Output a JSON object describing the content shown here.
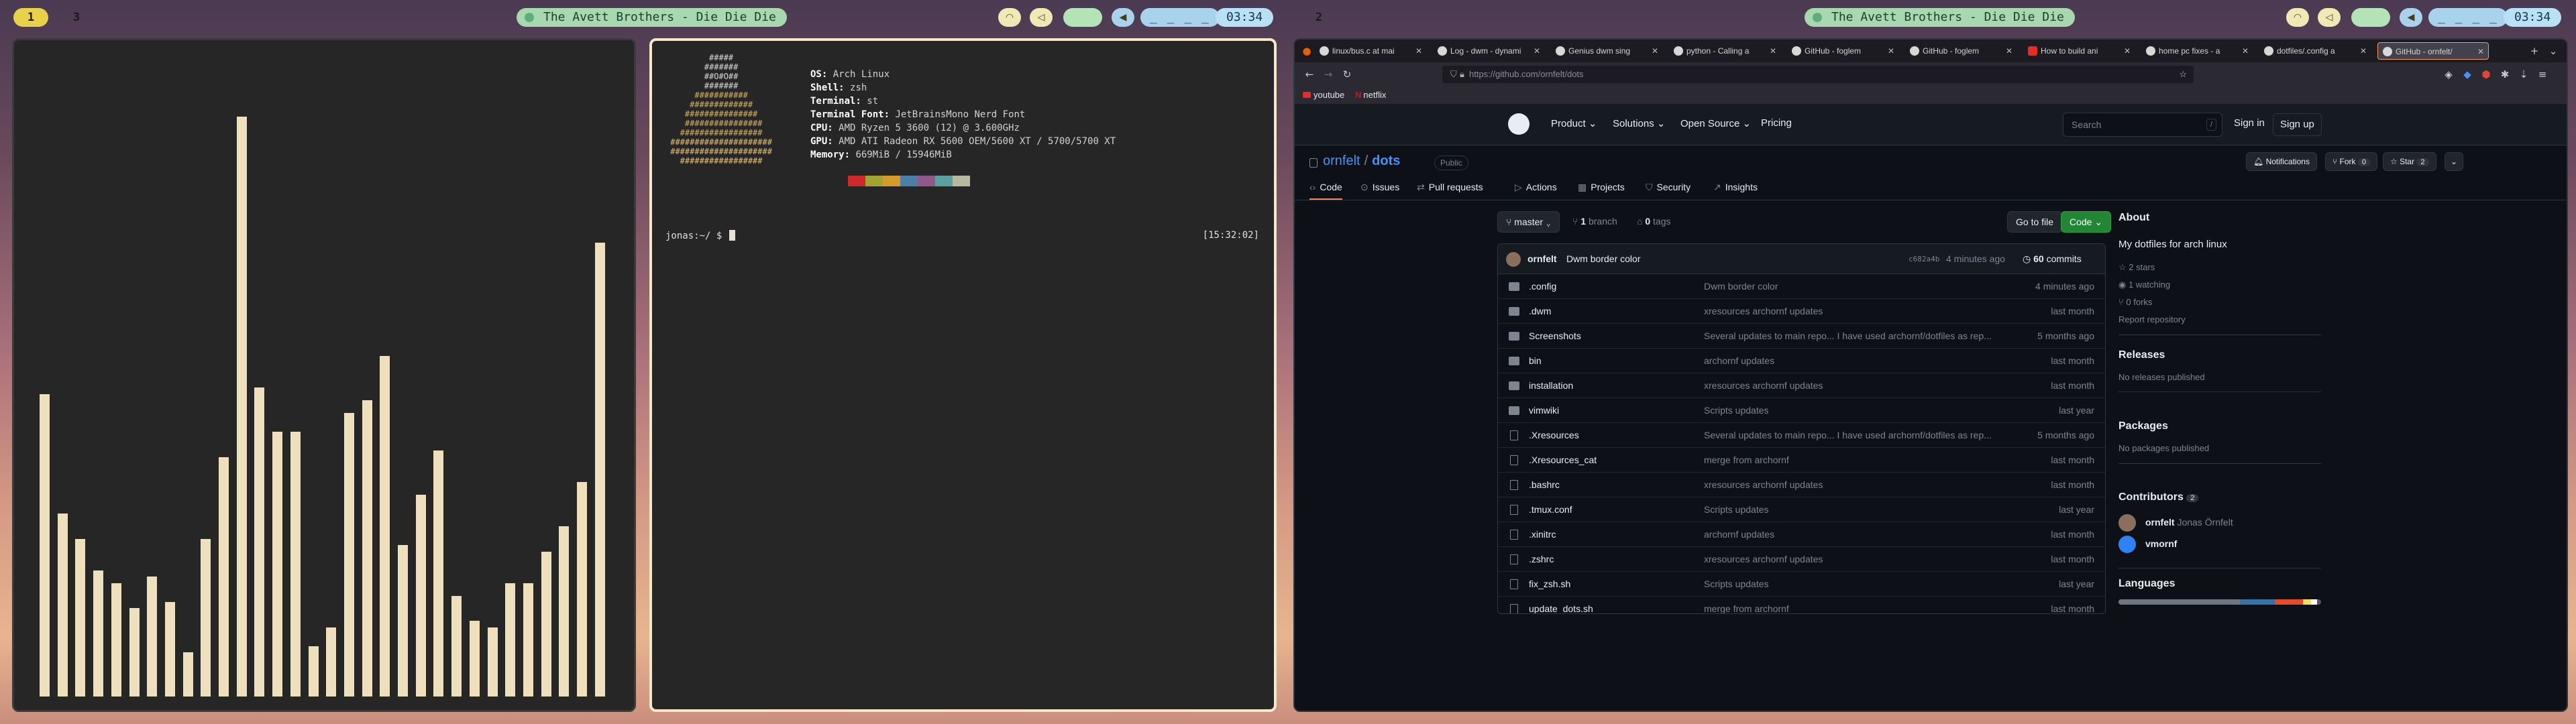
{
  "left_monitor": {
    "bar": {
      "workspaces": [
        "1",
        "3"
      ],
      "now_playing": "The Avett Brothers - Die Die Die",
      "date_text": "_ _ _ _",
      "clock": "03:34"
    },
    "visualizer_levels": [
      0.48,
      0.29,
      0.25,
      0.2,
      0.18,
      0.14,
      0.19,
      0.15,
      0.07,
      0.25,
      0.38,
      0.92,
      0.49,
      0.42,
      0.42,
      0.08,
      0.11,
      0.45,
      0.47,
      0.54,
      0.24,
      0.32,
      0.39,
      0.16,
      0.12,
      0.11,
      0.18,
      0.18,
      0.23,
      0.27,
      0.34,
      0.72
    ],
    "terminal": {
      "ascii_lines": [
        "         #####",
        "        #######",
        "        ##O#O##",
        "        #######",
        "      ###########",
        "     #############",
        "    ###############",
        "    ################",
        "   #################",
        " #####################",
        " #####################",
        "   #################"
      ],
      "info": [
        {
          "key": "OS:",
          "value": "Arch Linux"
        },
        {
          "key": "Shell:",
          "value": "zsh"
        },
        {
          "key": "Terminal:",
          "value": "st"
        },
        {
          "key": "Terminal Font:",
          "value": "JetBrainsMono Nerd Font"
        },
        {
          "key": "CPU:",
          "value": "AMD Ryzen 5 3600 (12) @ 3.600GHz"
        },
        {
          "key": "GPU:",
          "value": "AMD ATI Radeon RX 5600 OEM/5600 XT / 5700/5700 XT"
        },
        {
          "key": "Memory:",
          "value": "669MiB / 15946MiB"
        }
      ],
      "palette": [
        "#262626",
        "#cc2a2a",
        "#a3a332",
        "#d49a2a",
        "#4a7fa8",
        "#8f5a8a",
        "#5aa0a0",
        "#b8b8a0"
      ],
      "prompt": "jonas:~/ $",
      "timestamp": "[15:32:02]"
    }
  },
  "right_monitor": {
    "bar": {
      "workspaces": [
        "2"
      ],
      "now_playing": "The Avett Brothers - Die Die Die",
      "date_text": "_ _ _ _",
      "clock": "03:34"
    },
    "browser": {
      "tabs": [
        {
          "title": "linux/bus.c at mai",
          "active": false
        },
        {
          "title": "Log - dwm - dynami",
          "active": false
        },
        {
          "title": "Genius dwm sing",
          "active": false
        },
        {
          "title": "python - Calling a",
          "active": false
        },
        {
          "title": "GitHub - foglem",
          "active": false
        },
        {
          "title": "GitHub - foglem",
          "active": false
        },
        {
          "title": "How to build ani",
          "active": false,
          "youtube": true
        },
        {
          "title": "home pc fixes - a",
          "active": false
        },
        {
          "title": "dotfiles/.config a",
          "active": false
        },
        {
          "title": "GitHub - ornfelt/",
          "active": true
        }
      ],
      "url": "https://github.com/ornfelt/dots",
      "bookmarks": [
        "youtube",
        "netflix"
      ],
      "github": {
        "nav": [
          "Product",
          "Solutions",
          "Open Source",
          "Pricing"
        ],
        "search_placeholder": "Search",
        "search_key": "/",
        "sign_in": "Sign in",
        "sign_up": "Sign up",
        "owner": "ornfelt",
        "repo": "dots",
        "visibility": "Public",
        "notifications": "Notifications",
        "fork_label": "Fork",
        "fork_count": "0",
        "star_label": "Star",
        "star_count": "2",
        "repo_tabs": [
          "Code",
          "Issues",
          "Pull requests",
          "Actions",
          "Projects",
          "Security",
          "Insights"
        ],
        "branch": "master",
        "branch_count": "1",
        "branch_label": "branch",
        "tags_count": "0",
        "tags_label": "tags",
        "go_to_file": "Go to file",
        "code_button": "Code",
        "commit": {
          "author": "ornfelt",
          "message": "Dwm border color",
          "sha": "c682a4b",
          "time": "4 minutes ago",
          "count": "60",
          "count_label": "commits"
        },
        "files": [
          {
            "name": ".config",
            "type": "dir",
            "msg": "Dwm border color",
            "time": "4 minutes ago"
          },
          {
            "name": ".dwm",
            "type": "dir",
            "msg": "xresources archornf updates",
            "time": "last month"
          },
          {
            "name": "Screenshots",
            "type": "dir",
            "msg": "Several updates to main repo... I have used archornf/dotfiles as rep...",
            "time": "5 months ago"
          },
          {
            "name": "bin",
            "type": "dir",
            "msg": "archornf updates",
            "time": "last month"
          },
          {
            "name": "installation",
            "type": "dir",
            "msg": "xresources archornf updates",
            "time": "last month"
          },
          {
            "name": "vimwiki",
            "type": "dir",
            "msg": "Scripts updates",
            "time": "last year"
          },
          {
            "name": ".Xresources",
            "type": "file",
            "msg": "Several updates to main repo... I have used archornf/dotfiles as rep...",
            "time": "5 months ago"
          },
          {
            "name": ".Xresources_cat",
            "type": "file",
            "msg": "merge from archornf",
            "time": "last month"
          },
          {
            "name": ".bashrc",
            "type": "file",
            "msg": "xresources archornf updates",
            "time": "last month"
          },
          {
            "name": ".tmux.conf",
            "type": "file",
            "msg": "Scripts updates",
            "time": "last year"
          },
          {
            "name": ".xinitrc",
            "type": "file",
            "msg": "archornf updates",
            "time": "last month"
          },
          {
            "name": ".zshrc",
            "type": "file",
            "msg": "xresources archornf updates",
            "time": "last month"
          },
          {
            "name": "fix_zsh.sh",
            "type": "file",
            "msg": "Scripts updates",
            "time": "last year"
          },
          {
            "name": "update_dots.sh",
            "type": "file",
            "msg": "merge from archornf",
            "time": "last month"
          }
        ],
        "about": {
          "heading": "About",
          "description": "My dotfiles for arch linux",
          "stars": "2 stars",
          "watching": "1 watching",
          "forks": "0 forks",
          "report": "Report repository",
          "releases_heading": "Releases",
          "releases_text": "No releases published",
          "packages_heading": "Packages",
          "packages_text": "No packages published",
          "contributors_heading": "Contributors",
          "contributors_count": "2",
          "contributors": [
            {
              "login": "ornfelt",
              "name": "Jonas Örnfelt"
            },
            {
              "login": "vmornf",
              "name": ""
            }
          ],
          "languages_heading": "Languages",
          "language_colors": [
            "#89e051",
            "#3572a5",
            "#e34c26",
            "#f1e05a",
            "#ffffff",
            "#555555"
          ]
        }
      }
    }
  }
}
